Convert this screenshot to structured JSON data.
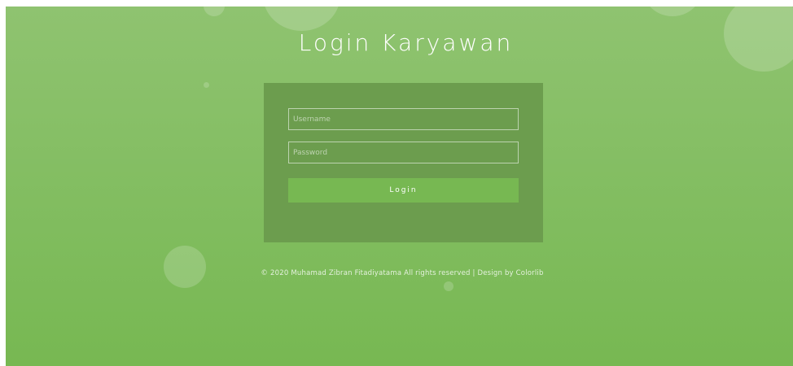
{
  "page": {
    "title": "Login Karyawan"
  },
  "form": {
    "username_placeholder": "Username",
    "password_placeholder": "Password",
    "login_label": "Login"
  },
  "footer": {
    "text": "© 2020 Muhamad Zibran Fitadiyatama All rights reserved | Design by Colorlib"
  },
  "colors": {
    "background_top": "#8fc370",
    "background_bottom": "#77b852",
    "panel": "#6c9d4e",
    "button": "#77b852"
  }
}
